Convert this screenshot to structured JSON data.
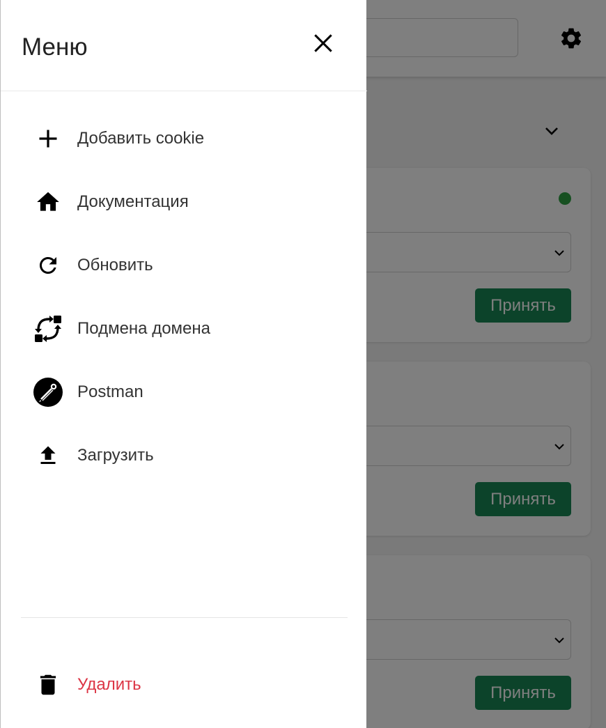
{
  "background": {
    "accept_label": "Принять",
    "colors": {
      "accept": "#198754",
      "status_ok": "#2ea043"
    },
    "icons": {
      "settings": "gear-icon",
      "filter": "chevron-down-icon"
    }
  },
  "menu": {
    "title": "Меню",
    "close_icon": "close-icon",
    "items": [
      {
        "label": "Добавить cookie",
        "icon": "plus-icon"
      },
      {
        "label": "Документация",
        "icon": "home-icon"
      },
      {
        "label": "Обновить",
        "icon": "refresh-icon"
      },
      {
        "label": "Подмена домена",
        "icon": "swap-icon"
      },
      {
        "label": "Postman",
        "icon": "postman-icon"
      },
      {
        "label": "Загрузить",
        "icon": "upload-icon"
      }
    ],
    "delete": {
      "label": "Удалить",
      "icon": "trash-icon",
      "color": "#dc3545"
    }
  }
}
